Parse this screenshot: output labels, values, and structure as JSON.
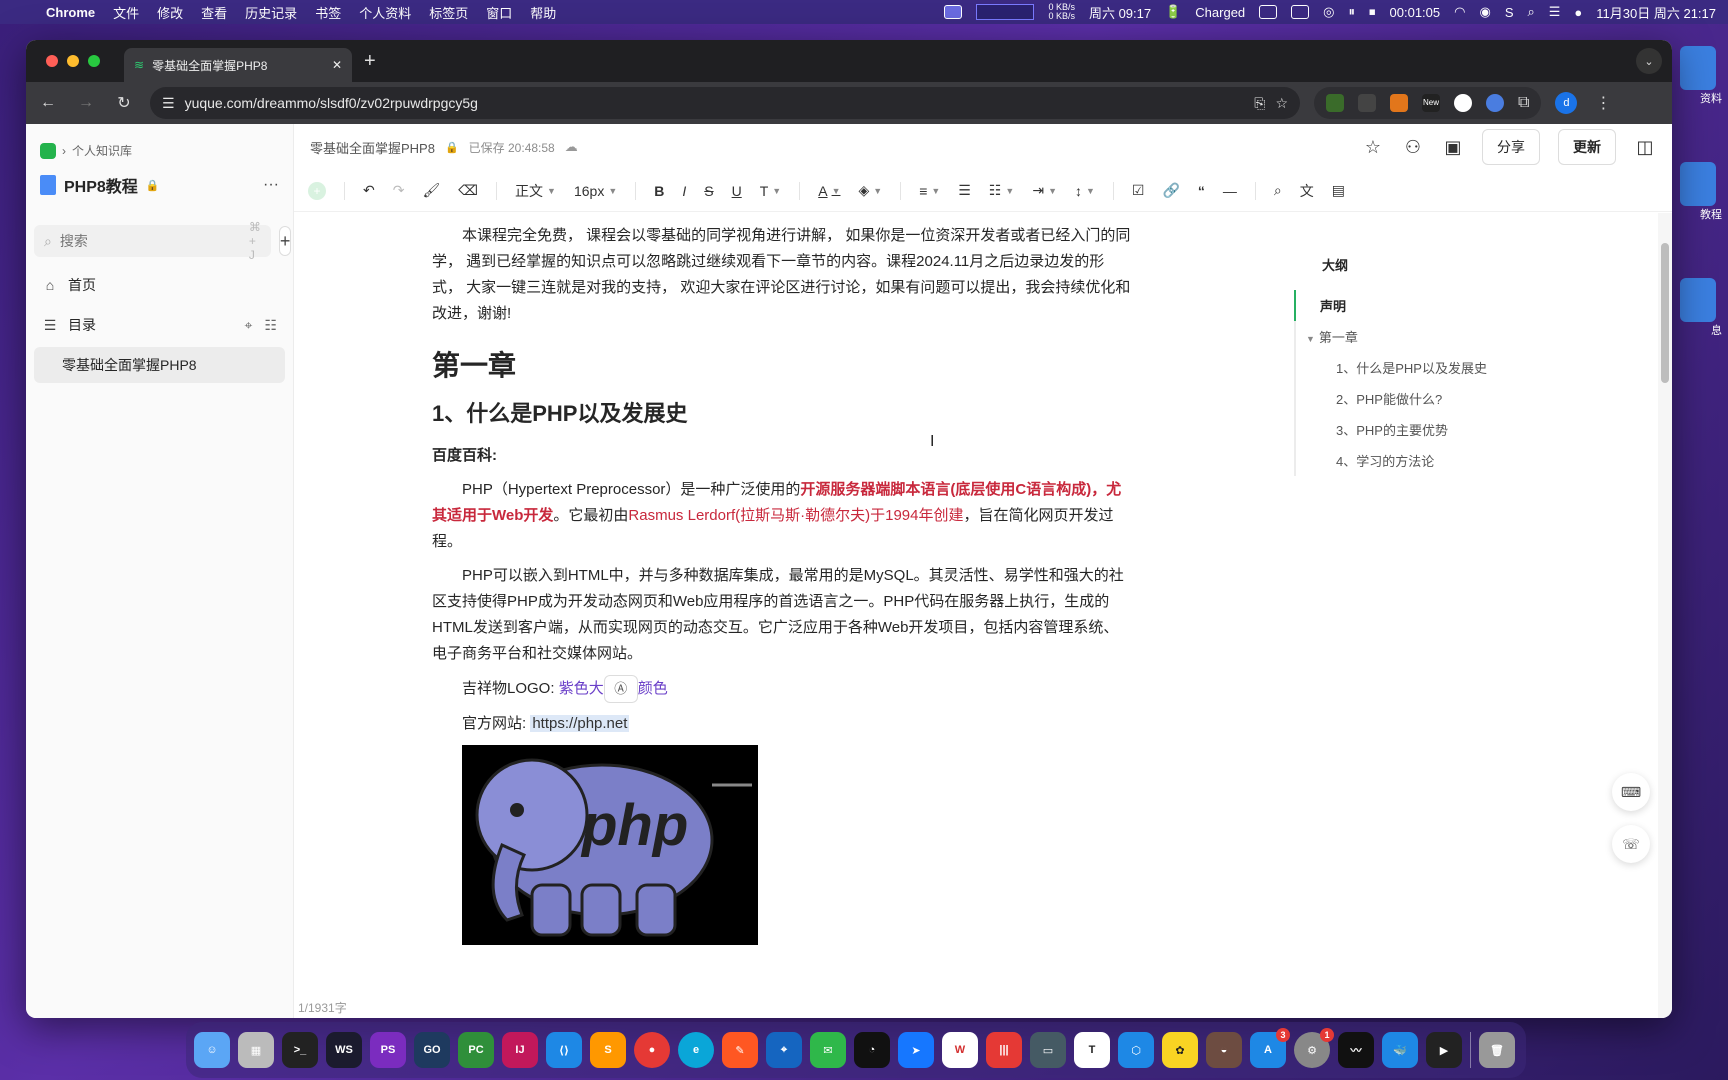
{
  "menubar": {
    "apple": "",
    "app": "Chrome",
    "items": [
      "文件",
      "修改",
      "查看",
      "历史记录",
      "书签",
      "个人资料",
      "标签页",
      "窗口",
      "帮助"
    ],
    "net_up": "0 KB/s",
    "net_down": "0 KB/s",
    "weekday_time": "周六 09:17",
    "battery": "Charged",
    "timer": "00:01:05",
    "datetime": "11月30日 周六 21:17"
  },
  "browser": {
    "tab_title": "零基础全面掌握PHP8",
    "url": "yuque.com/dreammo/slsdf0/zv02rpuwdrpgcy5g",
    "profile_initial": "d",
    "ext_new_label": "New"
  },
  "sidebar": {
    "breadcrumb": "个人知识库",
    "book_title": "PHP8教程",
    "search_placeholder": "搜索",
    "search_shortcut": "⌘ + J",
    "home": "首页",
    "toc": "目录",
    "doc_item": "零基础全面掌握PHP8"
  },
  "doc_header": {
    "title": "零基础全面掌握PHP8",
    "saved": "已保存 20:48:58",
    "share": "分享",
    "update": "更新"
  },
  "editor_toolbar": {
    "paragraph": "正文",
    "font_size": "16px"
  },
  "article": {
    "intro": "本课程完全免费， 课程会以零基础的同学视角进行讲解， 如果你是一位资深开发者或者已经入门的同学， 遇到已经掌握的知识点可以忽略跳过继续观看下一章节的内容。课程2024.11月之后边录边发的形式， 大家一键三连就是对我的支持， 欢迎大家在评论区进行讨论，如果有问题可以提出，我会持续优化和改进，谢谢!",
    "chapter": "第一章",
    "section": "1、什么是PHP以及发展史",
    "baidu_label": "百度百科:",
    "p1_a": "PHP（Hypertext Preprocessor）是一种广泛使用的",
    "p1_red": "开源服务器端脚本语言(底层使用C语言构成)，尤其适用于Web开发",
    "p1_b": "。它最初由",
    "p1_red2": "Rasmus Lerdorf(拉斯马斯·勒德尔夫)于1994年创建",
    "p1_c": "，旨在简化网页开发过程。",
    "p2": "PHP可以嵌入到HTML中，并与多种数据库集成，最常用的是MySQL。其灵活性、易学性和强大的社区支持使得PHP成为开发动态网页和Web应用程序的首选语言之一。PHP代码在服务器上执行，生成的HTML发送到客户端，从而实现网页的动态交互。它广泛应用于各种Web开发项目，包括内容管理系统、电子商务平台和社交媒体网站。",
    "logo_label": "吉祥物LOGO:",
    "logo_value_a": "紫色大",
    "logo_value_b": "颜色",
    "site_label": "官方网站:",
    "site_url": "https://php.net",
    "image_text": "php"
  },
  "outline": {
    "title": "大纲",
    "items": [
      {
        "label": "声明"
      },
      {
        "label": "第一章"
      },
      {
        "label": "1、什么是PHP以及发展史"
      },
      {
        "label": "2、PHP能做什么?"
      },
      {
        "label": "3、PHP的主要优势"
      },
      {
        "label": "4、学习的方法论"
      }
    ]
  },
  "status": {
    "wordcount": "1/1931字"
  },
  "desktop": {
    "labels": [
      "资料",
      "教程",
      "息"
    ]
  },
  "dock": {
    "badge_appstore": "3",
    "badge_settings": "1",
    "labels": [
      "WS",
      "PS",
      "GO",
      "PC",
      "IJ",
      "T"
    ]
  },
  "colors": {
    "accent_red": "#c8283c",
    "accent_purple": "#6a3fc8",
    "outline_active": "#26b062",
    "php_purple": "#7b7fc8"
  }
}
